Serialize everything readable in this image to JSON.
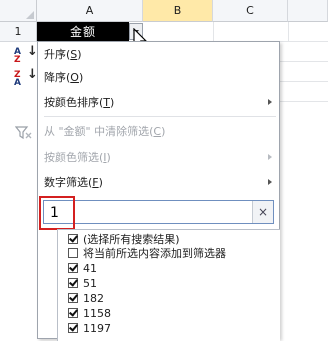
{
  "sheet": {
    "columns": [
      "A",
      "B",
      "C"
    ],
    "row_number": "1",
    "cell_a1": "金额"
  },
  "menu": {
    "sort_asc": {
      "label": "升序",
      "key": "S"
    },
    "sort_desc": {
      "label": "降序",
      "key": "O"
    },
    "sort_by_color": {
      "label": "按颜色排序",
      "key": "T"
    },
    "clear_filter": {
      "label": "从 \"金额\" 中清除筛选",
      "key": "C"
    },
    "filter_by_color": {
      "label": "按颜色筛选",
      "key": "I"
    },
    "number_filter": {
      "label": "数字筛选",
      "key": "F"
    }
  },
  "search": {
    "value": "1",
    "clear_icon": "×"
  },
  "checklist": [
    {
      "label": "(选择所有搜索结果)",
      "checked": true
    },
    {
      "label": "将当前所选内容添加到筛选器",
      "checked": false
    },
    {
      "label": "41",
      "checked": true
    },
    {
      "label": "51",
      "checked": true
    },
    {
      "label": "182",
      "checked": true
    },
    {
      "label": "1158",
      "checked": true
    },
    {
      "label": "1197",
      "checked": true
    }
  ],
  "icons": {
    "sort_asc_icon": "sort-az-icon",
    "sort_desc_icon": "sort-za-icon",
    "clear_filter_icon": "filter-clear-icon",
    "dropdown_icon": "chevron-down-icon"
  },
  "colors": {
    "selected_column_header": "#ffe9a8",
    "highlight_box": "#d42020",
    "menu_border": "#9ea4ad"
  }
}
